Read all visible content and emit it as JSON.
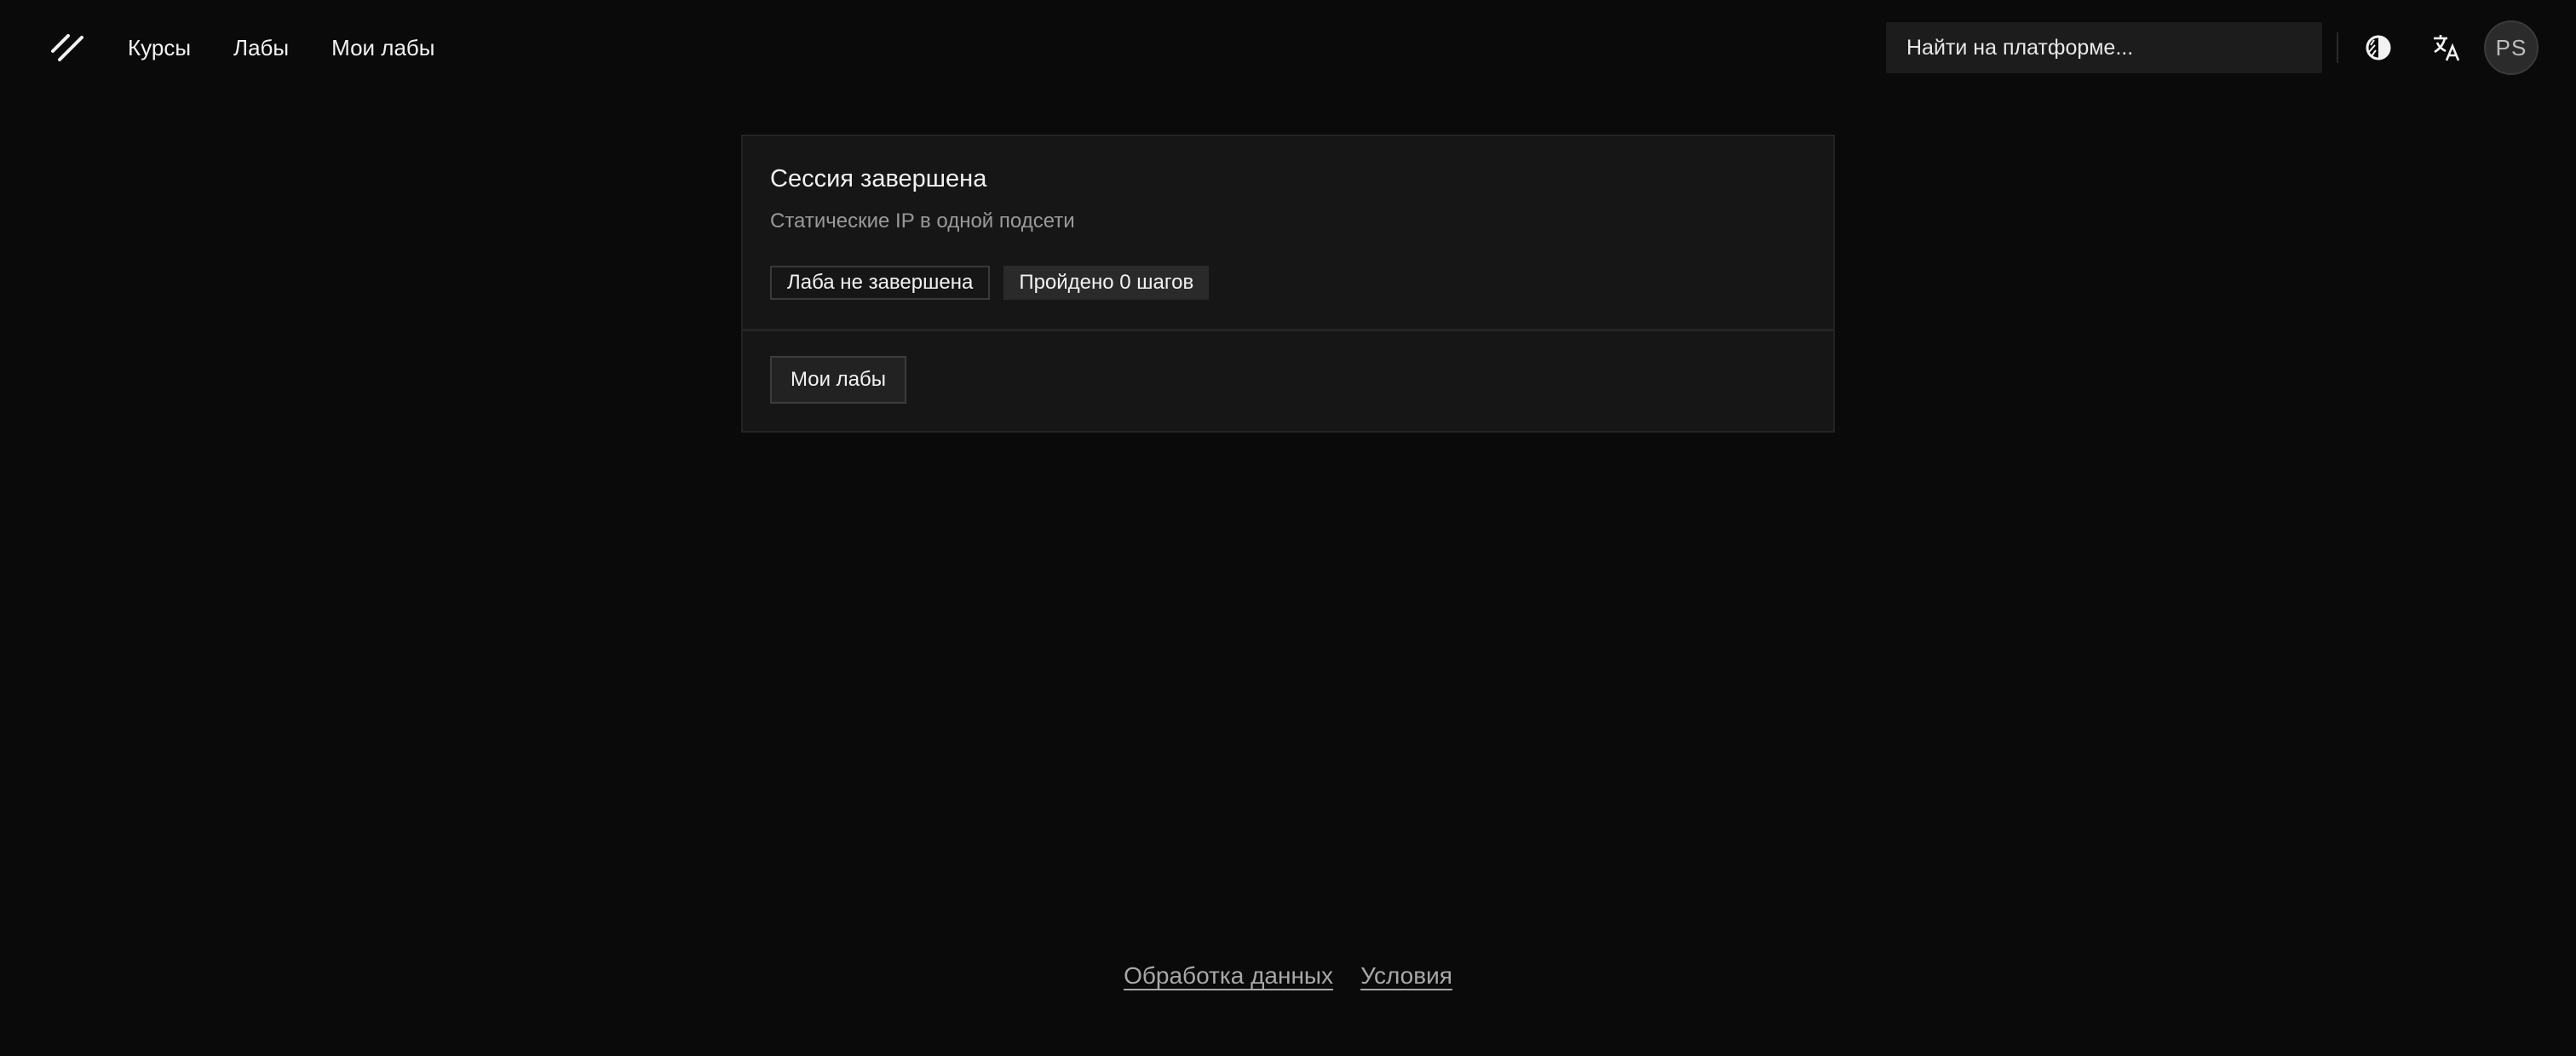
{
  "header": {
    "logo_icon": "slash-logo-icon",
    "nav": [
      {
        "label": "Курсы"
      },
      {
        "label": "Лабы"
      },
      {
        "label": "Мои лабы"
      }
    ],
    "search": {
      "placeholder": "Найти на платформе..."
    },
    "theme_icon": "contrast-icon",
    "language_icon": "translate-icon",
    "avatar_initials": "PS"
  },
  "card": {
    "title": "Сессия завершена",
    "subtitle": "Статические IP в одной подсети",
    "badges": [
      {
        "label": "Лаба не завершена"
      },
      {
        "label": "Пройдено 0 шагов"
      }
    ],
    "button_label": "Мои лабы"
  },
  "footer": {
    "links": [
      {
        "label": "Обработка данных"
      },
      {
        "label": "Условия"
      }
    ]
  },
  "colors": {
    "background": "#0a0a0a",
    "card": "#161616",
    "text": "#f2f2f2",
    "muted": "#9a9a9a"
  }
}
